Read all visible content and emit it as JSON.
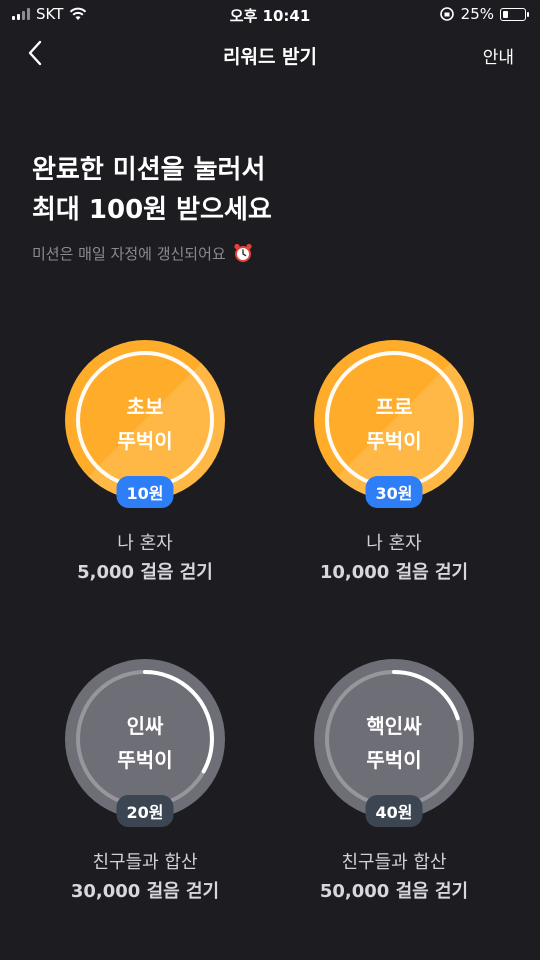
{
  "status": {
    "carrier": "SKT",
    "time": "오후 10:41",
    "battery": "25%",
    "battery_level": 0.25
  },
  "nav": {
    "title": "리워드 받기",
    "guide": "안내"
  },
  "header": {
    "line1": "완료한 미션을 눌러서",
    "line2": "최대 100원 받으세요",
    "sub": "미션은 매일 자정에 갱신되어요"
  },
  "missions": [
    {
      "name1": "초보",
      "name2": "뚜벅이",
      "reward": "10원",
      "who": "나 혼자",
      "goal": "5,000 걸음 걷기",
      "state": "completed",
      "progress": 1.0
    },
    {
      "name1": "프로",
      "name2": "뚜벅이",
      "reward": "30원",
      "who": "나 혼자",
      "goal": "10,000 걸음 걷기",
      "state": "completed",
      "progress": 1.0
    },
    {
      "name1": "인싸",
      "name2": "뚜벅이",
      "reward": "20원",
      "who": "친구들과 합산",
      "goal": "30,000 걸음 걷기",
      "state": "in-progress",
      "progress": 0.33
    },
    {
      "name1": "핵인싸",
      "name2": "뚜벅이",
      "reward": "40원",
      "who": "친구들과 합산",
      "goal": "50,000 걸음 걷기",
      "state": "in-progress",
      "progress": 0.2
    }
  ],
  "colors": {
    "background": "#1c1c21",
    "orange": "#ffac2a",
    "blue_badge": "#2d7ef7",
    "gray_circle": "#6e6e76"
  }
}
